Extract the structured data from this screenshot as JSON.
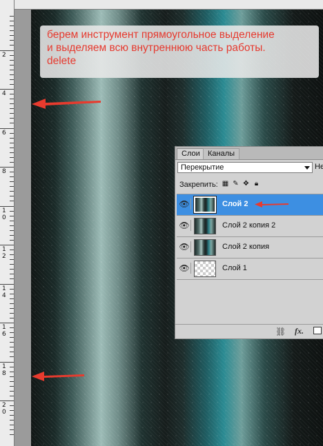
{
  "ruler": {
    "labels": [
      "2",
      "4",
      "6",
      "8",
      "10",
      "12",
      "14",
      "16",
      "18",
      "20"
    ]
  },
  "instruction": {
    "text_line1": "берем инструмент прямоугольное выделение",
    "text_line2": "и выделяем всю внутреннюю часть работы.",
    "text_line3": "delete",
    "color": "#e63a2f"
  },
  "layers_panel": {
    "tabs": {
      "layers": "Слои",
      "channels": "Каналы"
    },
    "blend_mode": "Перекрытие",
    "opacity_label_partial": "Не",
    "lock_label": "Закрепить:",
    "layers": [
      {
        "name": "Слой 2",
        "selected": true
      },
      {
        "name": "Слой 2 копия 2",
        "selected": false
      },
      {
        "name": "Слой 2 копия",
        "selected": false
      },
      {
        "name": "Слой 1",
        "selected": false
      }
    ],
    "footer": {
      "link_icon": "link-icon",
      "fx_label": "fx.",
      "mask_icon": "mask-icon"
    },
    "selected_color": "#3d8fe2"
  }
}
